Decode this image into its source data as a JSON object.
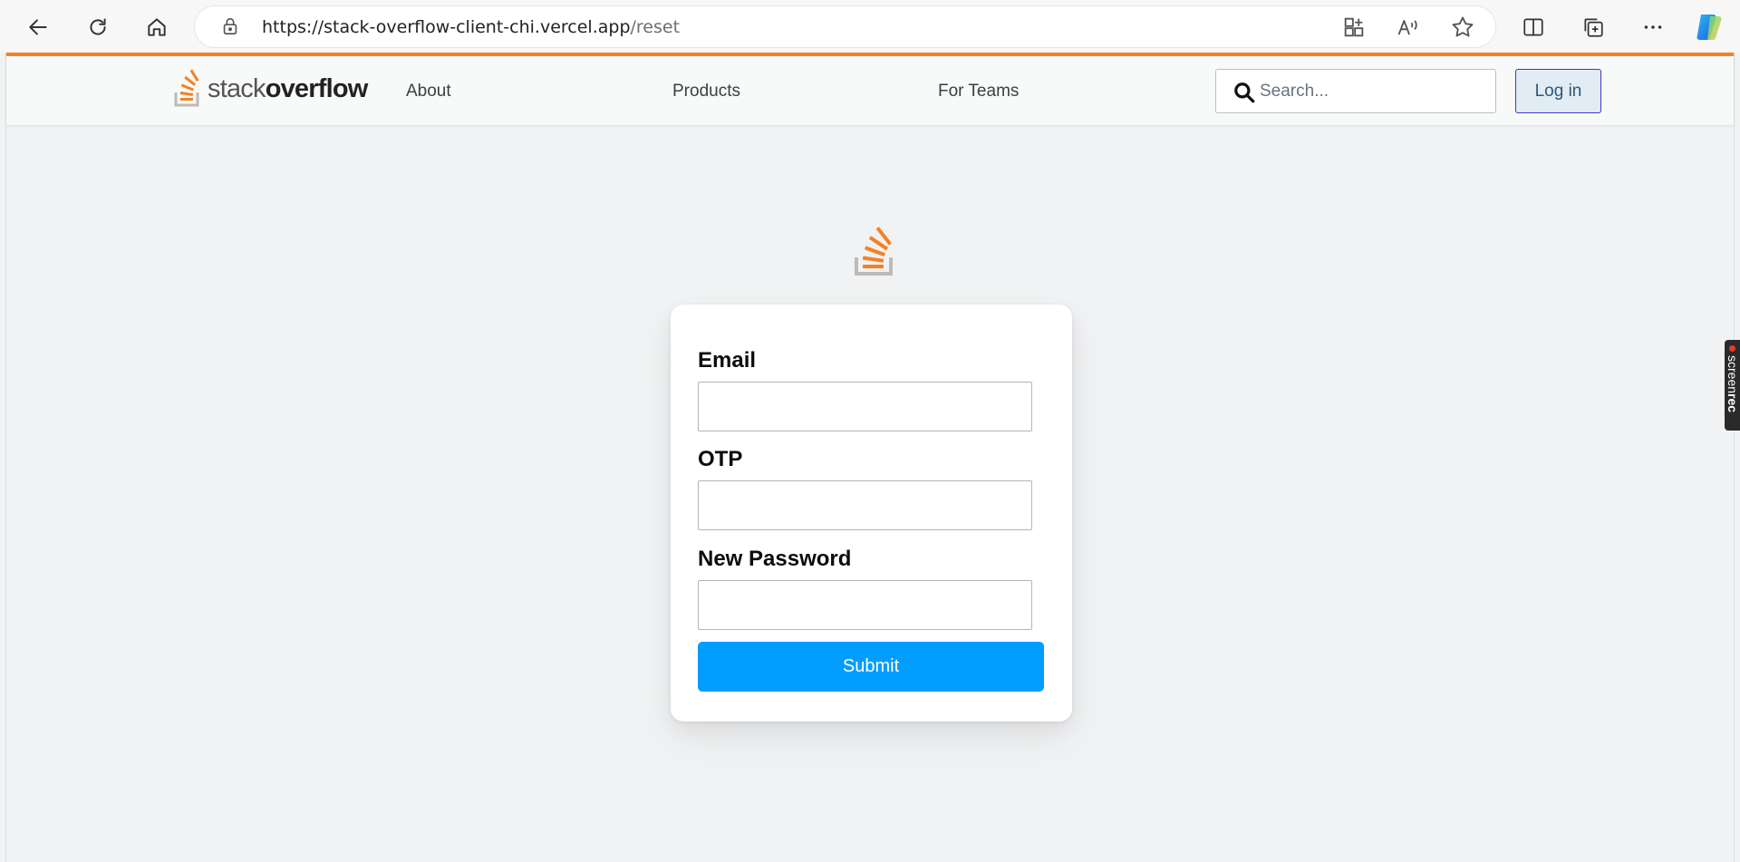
{
  "browser": {
    "url_host": "https://stack-overflow-client-chi.vercel.app",
    "url_path": "/reset"
  },
  "navbar": {
    "logo_light": "stack",
    "logo_bold": "overflow",
    "links": [
      "About",
      "Products",
      "For Teams"
    ],
    "search_placeholder": "Search...",
    "login_label": "Log in"
  },
  "form": {
    "email_label": "Email",
    "otp_label": "OTP",
    "password_label": "New Password",
    "submit_label": "Submit"
  },
  "overlay": {
    "screenrec_light": "screen",
    "screenrec_bold": "rec"
  },
  "colors": {
    "accent": "#f48024",
    "submit": "#009dff",
    "background": "#f1f2f3"
  }
}
